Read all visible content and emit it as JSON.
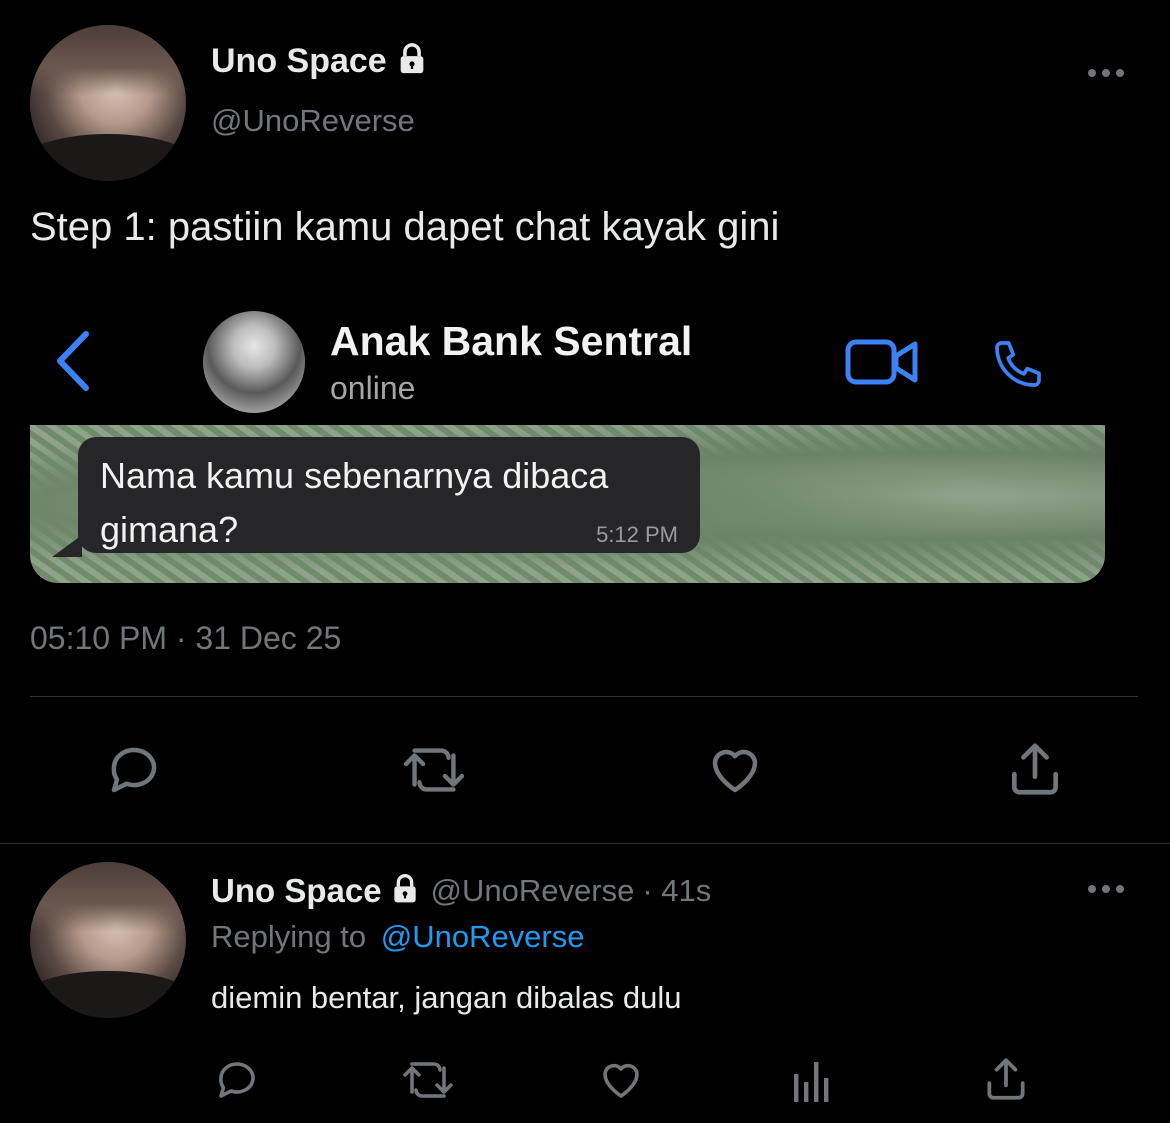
{
  "tweet": {
    "author_name": "Uno Space",
    "author_handle": "@UnoReverse",
    "text": "Step 1: pastiin kamu dapet chat kayak gini",
    "timestamp": "05:10 PM · 31 Dec 25",
    "more_icon": "more-horizontal-icon",
    "lock_icon": "lock-icon"
  },
  "embedded_chat": {
    "contact_name": "Anak Bank Sentral",
    "status": "online",
    "message_line1": "Nama kamu sebenarnya dibaca",
    "message_line2": "gimana?",
    "message_time": "5:12 PM",
    "accent_color": "#3b82f6"
  },
  "actions": [
    "reply-icon",
    "retweet-icon",
    "like-icon",
    "share-icon"
  ],
  "reply": {
    "author_name": "Uno Space",
    "author_handle": "@UnoReverse",
    "age": "· 41s",
    "replying_prefix": "Replying to",
    "replying_to": "@UnoReverse",
    "text": "diemin bentar, jangan dibalas dulu",
    "link_color": "#1d9bf0"
  },
  "reply_actions": [
    "reply-icon",
    "retweet-icon",
    "like-icon",
    "analytics-icon",
    "share-icon"
  ]
}
